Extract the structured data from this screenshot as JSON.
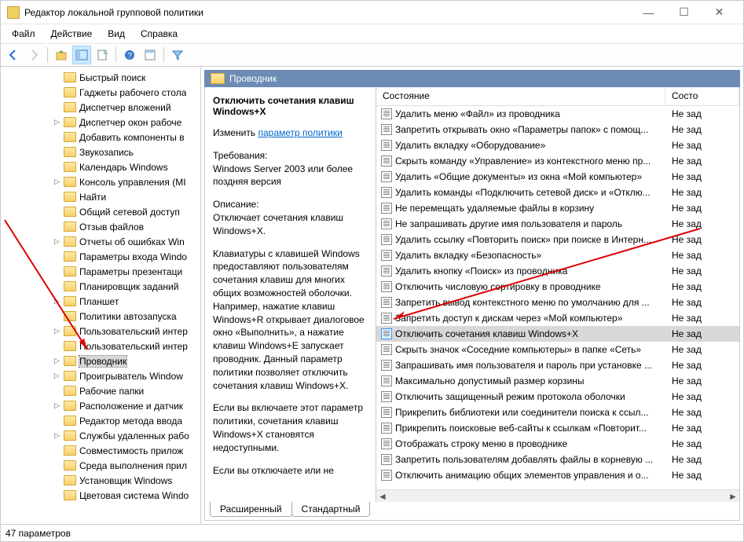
{
  "window": {
    "title": "Редактор локальной групповой политики"
  },
  "menu": {
    "file": "Файл",
    "action": "Действие",
    "view": "Вид",
    "help": "Справка"
  },
  "header": {
    "title": "Проводник"
  },
  "desc": {
    "policy_title": "Отключить сочетания клавиш Windows+X",
    "edit_prefix": "Изменить ",
    "edit_link": "параметр политики",
    "req_label": "Требования:",
    "req_text": "Windows Server 2003 или более поздняя версия",
    "brief_label": "Описание:",
    "brief_text": "Отключает сочетания клавиш Windows+X.",
    "para1": "Клавиатуры с клавишей Windows предоставляют пользователям сочетания клавиш для многих общих возможностей оболочки. Например, нажатие клавиш Windows+R открывает диалоговое окно «Выполнить», а нажатие клавиш Windows+E запускает проводник. Данный параметр политики позволяет отключить сочетания клавиш Windows+X.",
    "para2": "Если вы включаете этот параметр политики, сочетания клавиш Windows+X становятся недоступными.",
    "para3": "Если вы отключаете или не"
  },
  "columns": {
    "state": "Состояние",
    "state2": "Состо"
  },
  "tabs": {
    "extended": "Расширенный",
    "standard": "Стандартный"
  },
  "status": {
    "text": "47 параметров"
  },
  "state_default": "Не зад",
  "tree": [
    {
      "label": "Быстрый поиск",
      "exp": ""
    },
    {
      "label": "Гаджеты рабочего стола",
      "exp": ""
    },
    {
      "label": "Диспетчер вложений",
      "exp": ""
    },
    {
      "label": "Диспетчер окон рабоче",
      "exp": ">"
    },
    {
      "label": "Добавить компоненты в",
      "exp": ""
    },
    {
      "label": "Звукозапись",
      "exp": ""
    },
    {
      "label": "Календарь Windows",
      "exp": ""
    },
    {
      "label": "Консоль управления (MI",
      "exp": ">"
    },
    {
      "label": "Найти",
      "exp": ""
    },
    {
      "label": "Общий сетевой доступ",
      "exp": ""
    },
    {
      "label": "Отзыв файлов",
      "exp": ""
    },
    {
      "label": "Отчеты об ошибках Win",
      "exp": ">"
    },
    {
      "label": "Параметры входа Windo",
      "exp": ""
    },
    {
      "label": "Параметры презентаци",
      "exp": ""
    },
    {
      "label": "Планировщик заданий",
      "exp": ""
    },
    {
      "label": "Планшет",
      "exp": ">"
    },
    {
      "label": "Политики автозапуска",
      "exp": ""
    },
    {
      "label": "Пользовательский интер",
      "exp": ">"
    },
    {
      "label": "Пользовательский интер",
      "exp": ""
    },
    {
      "label": "Проводник",
      "exp": ">",
      "selected": true
    },
    {
      "label": "Проигрыватель Window",
      "exp": ">"
    },
    {
      "label": "Рабочие папки",
      "exp": ""
    },
    {
      "label": "Расположение и датчик",
      "exp": ">"
    },
    {
      "label": "Редактор метода ввода",
      "exp": ""
    },
    {
      "label": "Службы удаленных рабо",
      "exp": ">"
    },
    {
      "label": "Совместимость прилож",
      "exp": ""
    },
    {
      "label": "Среда выполнения прил",
      "exp": ""
    },
    {
      "label": "Установщик Windows",
      "exp": ""
    },
    {
      "label": "Цветовая система Windo",
      "exp": ""
    }
  ],
  "items": [
    {
      "name": "Удалить меню «Файл» из проводника"
    },
    {
      "name": "Запретить открывать окно «Параметры папок» с помощ..."
    },
    {
      "name": "Удалить вкладку «Оборудование»"
    },
    {
      "name": "Скрыть команду «Управление» из контекстного меню пр..."
    },
    {
      "name": "Удалить «Общие документы» из окна «Мой компьютер»"
    },
    {
      "name": "Удалить команды «Подключить сетевой диск» и «Отклю..."
    },
    {
      "name": "Не перемещать удаляемые файлы в корзину"
    },
    {
      "name": "Не запрашивать другие имя пользователя и пароль"
    },
    {
      "name": "Удалить ссылку «Повторить поиск» при поиске в Интерн..."
    },
    {
      "name": "Удалить вкладку «Безопасность»"
    },
    {
      "name": "Удалить кнопку «Поиск» из проводника"
    },
    {
      "name": "Отключить числовую сортировку в проводнике"
    },
    {
      "name": "Запретить вывод контекстного меню по умолчанию для ..."
    },
    {
      "name": "Запретить доступ к дискам через «Мой компьютер»"
    },
    {
      "name": "Отключить сочетания клавиш Windows+X",
      "selected": true
    },
    {
      "name": "Скрыть значок «Соседние компьютеры» в папке «Сеть»"
    },
    {
      "name": "Запрашивать имя пользователя и пароль при установке ..."
    },
    {
      "name": "Максимально допустимый размер корзины"
    },
    {
      "name": "Отключить защищенный режим протокола оболочки"
    },
    {
      "name": "Прикрепить библиотеки или соединители поиска к ссыл..."
    },
    {
      "name": "Прикрепить поисковые веб-сайты к ссылкам «Повторит..."
    },
    {
      "name": "Отображать строку меню в проводнике"
    },
    {
      "name": "Запретить пользователям добавлять файлы в корневую ..."
    },
    {
      "name": "Отключить анимацию общих элементов управления и о..."
    }
  ]
}
